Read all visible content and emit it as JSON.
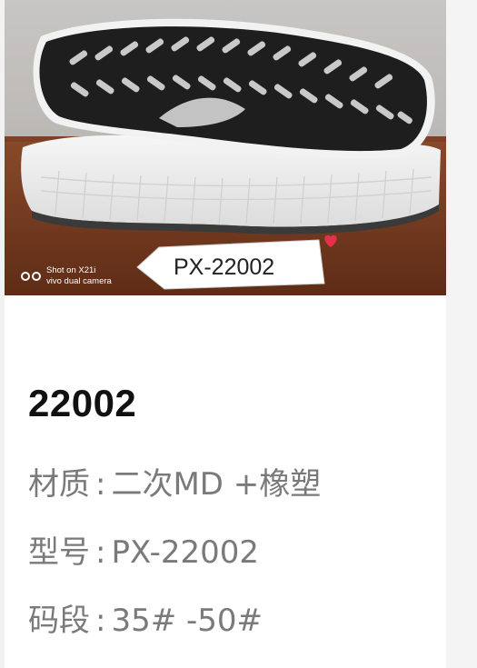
{
  "product_image": {
    "label_text": "PX-22002",
    "watermark_line1": "Shot on X21i",
    "watermark_line2": "vivo dual camera"
  },
  "product": {
    "title": "22002",
    "specs": [
      {
        "key": "材质",
        "sep": ":",
        "value": "二次MD +橡塑"
      },
      {
        "key": "型号",
        "sep": ":",
        "value": "PX-22002"
      },
      {
        "key": "码段",
        "sep": ":",
        "value": "35# -50#"
      }
    ]
  },
  "colors": {
    "title": "#111111",
    "spec_text": "#7a7a7a",
    "background": "#ffffff",
    "heart": "#e8304a"
  },
  "icons": [
    "camera-lens-icon",
    "heart-icon",
    "arrow-tag-icon"
  ]
}
